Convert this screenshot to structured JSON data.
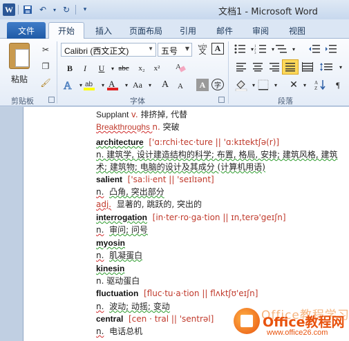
{
  "window": {
    "title": "文档1 - Microsoft Word"
  },
  "qat": {
    "app_icon": "W",
    "save_icon": "save-icon",
    "undo_icon": "undo-icon",
    "redo_icon": "redo-icon",
    "customize_icon": "customize-icon"
  },
  "tabs": [
    "文件",
    "开始",
    "插入",
    "页面布局",
    "引用",
    "邮件",
    "审阅",
    "视图"
  ],
  "ribbon": {
    "clipboard": {
      "paste_label": "粘贴",
      "group_label": "剪贴板"
    },
    "font": {
      "font_name": "Calibri (西文正文)",
      "font_size": "五号",
      "group_label": "字体",
      "bold": "B",
      "italic": "I",
      "underline": "U",
      "strikethrough": "abc",
      "subscript": "x₂",
      "superscript": "x²",
      "grow": "A",
      "shrink": "A",
      "change_case": "Aa",
      "wen": "wén",
      "char_border": "A"
    },
    "paragraph": {
      "group_label": "段落"
    }
  },
  "document": {
    "lines": [
      {
        "parts": [
          "Supplant ",
          "v.",
          " 排挤掉, 代替"
        ]
      },
      {
        "parts": [
          "Breakthroughs ",
          "n.",
          " 突破"
        ]
      },
      {
        "word": "architecture",
        "phon": "['ɑ:rchi·tec·ture || 'ɑ:kɪtektʃə(r)]"
      },
      {
        "text": "n.  建筑学, 设计建造结构的科学; 布置, 格局, 安排; 建筑风格, 建筑"
      },
      {
        "text": "术; 建筑物; 电脑的设计及其成分 (计算机用语)"
      },
      {
        "word": "salient",
        "phon": "['sa:li·ent || 'seɪlɪənt]"
      },
      {
        "pos": "n.",
        "text": "凸角, 突出部分"
      },
      {
        "pos": "adj.",
        "text": "显著的, 跳跃的, 突出的"
      },
      {
        "word": "interrogation",
        "phon": "[in·ter·ro·ga·tion || ɪn,terə'geɪʃn]"
      },
      {
        "pos": "n.",
        "text": "审问; 问号"
      },
      {
        "word": "myosin"
      },
      {
        "pos": "n.",
        "text": "肌凝蛋白"
      },
      {
        "word": "kinesin"
      },
      {
        "pos": "n.",
        "text": "驱动蛋白"
      },
      {
        "word": "fluctuation",
        "phon": "[fluc·tu·a·tion || flʌktʃʊ'eɪʃn]"
      },
      {
        "pos": "n.",
        "text": "波动; 动摇; 变动"
      },
      {
        "word": "central",
        "phon": "[cen · tral || 'sentrəl]"
      },
      {
        "pos": "n.",
        "text": "电话总机"
      }
    ]
  },
  "watermark": {
    "top_text": "Office教程学习网",
    "main_text": "Office教程网",
    "url": "www.office26.com"
  },
  "colors": {
    "red_text": "#c0392b",
    "watermark_orange": "#e8530e",
    "file_tab": "#2b5ea8"
  }
}
